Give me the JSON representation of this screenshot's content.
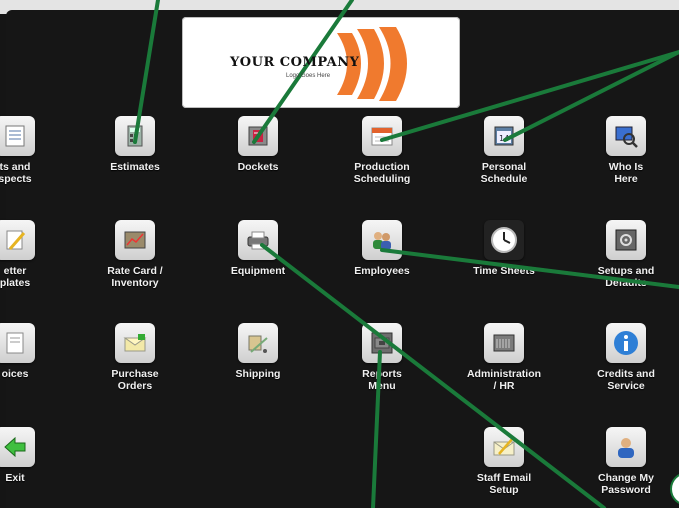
{
  "logo": {
    "company": "YOUR COMPANY",
    "tagline": "Logo Goes Here"
  },
  "menu": [
    {
      "label": "ts and\nspects",
      "icon": "document-icon"
    },
    {
      "label": "Estimates",
      "icon": "calculator-icon"
    },
    {
      "label": "Dockets",
      "icon": "docket-icon"
    },
    {
      "label": "Production\nScheduling",
      "icon": "calendar-icon"
    },
    {
      "label": "Personal\nSchedule",
      "icon": "desk-calendar-icon"
    },
    {
      "label": "Who Is\nHere",
      "icon": "magnifier-icon"
    },
    {
      "label": "etter\nplates",
      "icon": "pencil-icon"
    },
    {
      "label": "Rate Card /\nInventory",
      "icon": "ratecard-icon"
    },
    {
      "label": "Equipment",
      "icon": "printer-icon"
    },
    {
      "label": "Employees",
      "icon": "people-icon"
    },
    {
      "label": "Time Sheets",
      "icon": "clock-icon"
    },
    {
      "label": "Setups and\nDefaults",
      "icon": "safe-icon"
    },
    {
      "label": "oices",
      "icon": "invoice-icon"
    },
    {
      "label": "Purchase\nOrders",
      "icon": "purchase-order-icon"
    },
    {
      "label": "Shipping",
      "icon": "shipping-icon"
    },
    {
      "label": "Reports\nMenu",
      "icon": "reports-icon"
    },
    {
      "label": "Administration\n/ HR",
      "icon": "file-cabinet-icon"
    },
    {
      "label": "Credits and\nService",
      "icon": "info-icon"
    },
    {
      "label": "Exit",
      "icon": "exit-arrow-icon"
    },
    {
      "label": "Staff Email\nSetup",
      "icon": "email-setup-icon"
    },
    {
      "label": "Change My\nPassword",
      "icon": "user-password-icon"
    }
  ],
  "colors": {
    "background": "#161616",
    "annotation": "#1a7a3a",
    "logo_swoosh": "#f07a2e"
  }
}
